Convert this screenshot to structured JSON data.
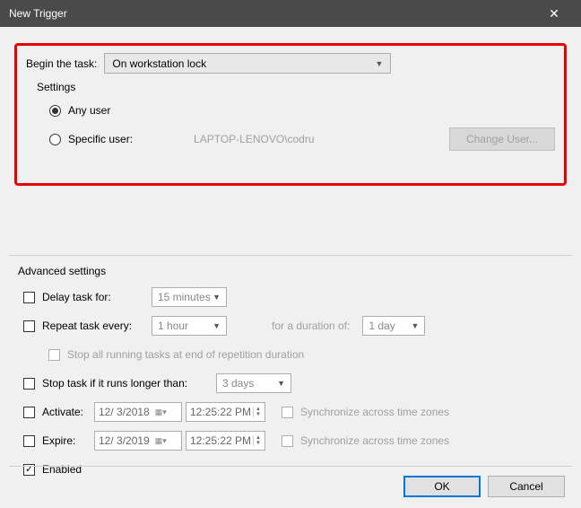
{
  "title": "New Trigger",
  "beginTask": {
    "label": "Begin the task:",
    "value": "On workstation lock"
  },
  "settings": {
    "label": "Settings",
    "anyUser": "Any user",
    "specificUser": "Specific user:",
    "specificUserValue": "LAPTOP-LENOVO\\codru",
    "changeUser": "Change User..."
  },
  "advanced": {
    "label": "Advanced settings",
    "delayTask": "Delay task for:",
    "delayValue": "15 minutes",
    "repeatTask": "Repeat task every:",
    "repeatValue": "1 hour",
    "durationLabel": "for a duration of:",
    "durationValue": "1 day",
    "stopAll": "Stop all running tasks at end of repetition duration",
    "stopIf": "Stop task if it runs longer than:",
    "stopIfValue": "3 days",
    "activate": "Activate:",
    "activateDate": "12/  3/2018",
    "activateTime": "12:25:22 PM",
    "expire": "Expire:",
    "expireDate": "12/  3/2019",
    "expireTime": "12:25:22 PM",
    "sync": "Synchronize across time zones",
    "enabled": "Enabled"
  },
  "buttons": {
    "ok": "OK",
    "cancel": "Cancel"
  }
}
